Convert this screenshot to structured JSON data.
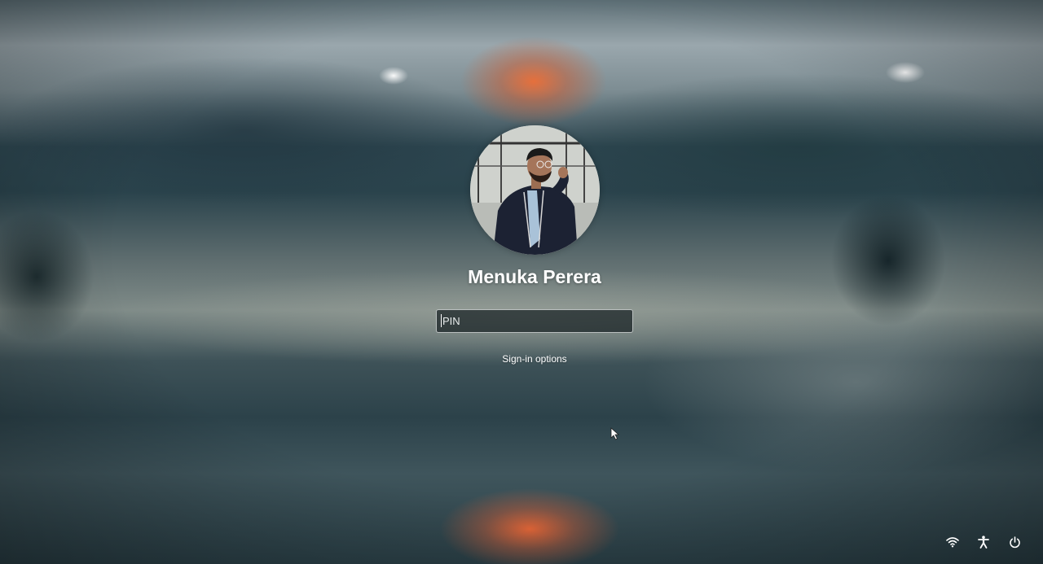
{
  "user": {
    "name": "Menuka Perera"
  },
  "pin": {
    "placeholder": "PIN",
    "value": ""
  },
  "sign_in_options": {
    "label": "Sign-in options"
  },
  "tray": {
    "icons": [
      "wifi-icon",
      "accessibility-icon",
      "power-icon"
    ]
  },
  "colors": {
    "text": "#ffffff",
    "accent_glow": "#eb6e37",
    "input_border": "#d2d7d7"
  }
}
